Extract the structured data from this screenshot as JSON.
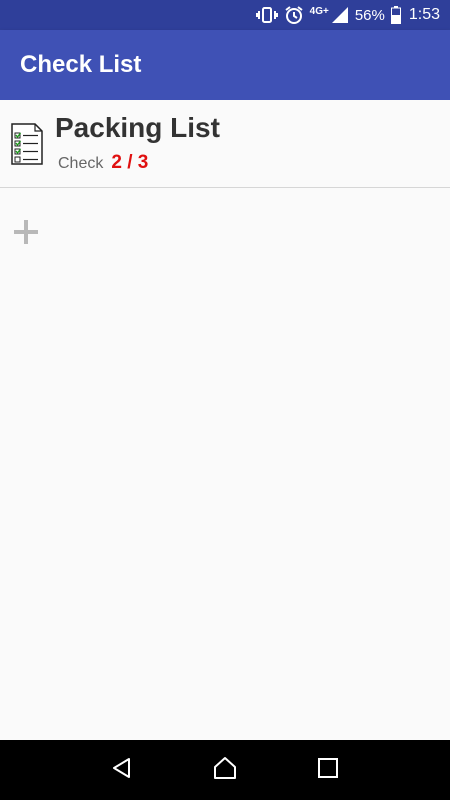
{
  "status_bar": {
    "network": "4G+",
    "battery": "56%",
    "time": "1:53",
    "icons": [
      "vibrate-icon",
      "alarm-icon",
      "signal-icon",
      "battery-icon"
    ]
  },
  "app_bar": {
    "title": "Check List",
    "color": "#3f51b5"
  },
  "lists": [
    {
      "title": "Packing List",
      "check_label": "Check",
      "check_count": "2 / 3",
      "icon": "checklist-icon"
    }
  ],
  "add_button": {
    "icon": "plus-icon"
  },
  "nav_bar": {
    "buttons": [
      "back-icon",
      "home-icon",
      "recents-icon"
    ]
  },
  "colors": {
    "status_bar": "#2f3f9a",
    "accent_count": "#e01010",
    "background": "#fafafa"
  }
}
